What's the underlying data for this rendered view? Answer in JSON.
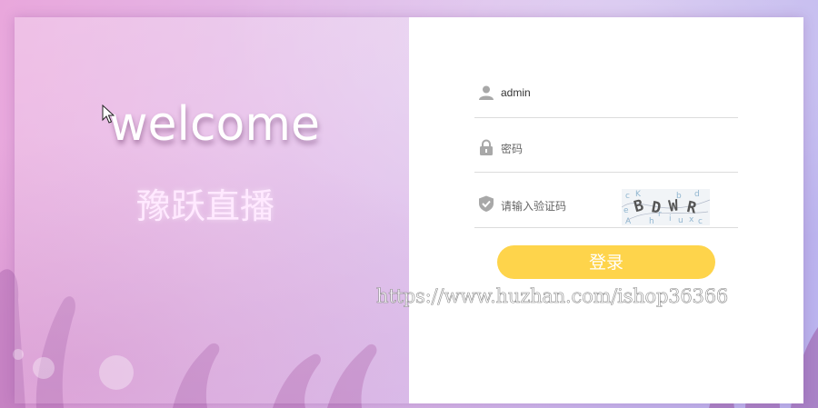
{
  "welcome_text": "welcome",
  "brand_name": "豫跃直播",
  "login_form": {
    "username_value": "admin",
    "password_placeholder": "密码",
    "captcha_placeholder": "请输入验证码",
    "captcha_text": "BDWR",
    "login_label": "登录"
  },
  "watermark": "https://www.huzhan.com/ishop36366",
  "colors": {
    "login_button": "#fed44b",
    "icon_gray": "#a8a8a8",
    "field_border": "#dcdcdc"
  },
  "icons": {
    "username": "user-icon",
    "password": "lock-icon",
    "captcha": "shield-check-icon"
  }
}
